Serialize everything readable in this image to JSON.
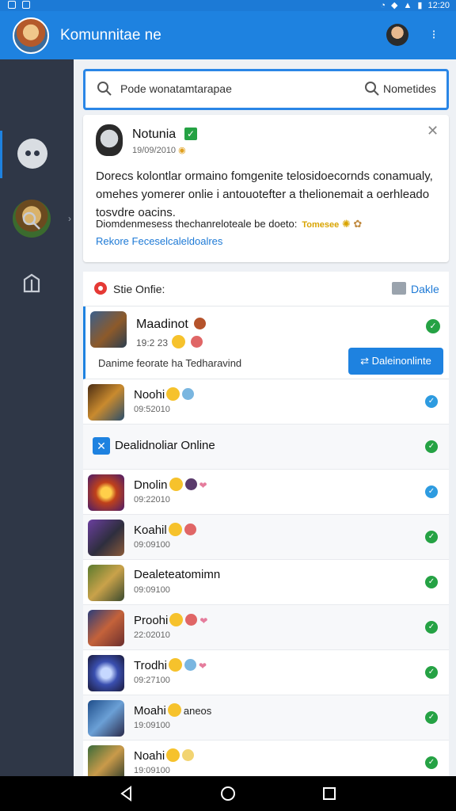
{
  "status_bar": {
    "time": "12:20"
  },
  "header": {
    "title": "Komunnitae ne"
  },
  "search": {
    "placeholder": "Pode wonatamtarapae",
    "right_label": "Nometides"
  },
  "notification": {
    "title": "Notunia",
    "subtitle": "19/09/2010",
    "body": "Dorecs kolontlar ormaino fomgenite telosidoecornds conamualy, omehes yomerer onlie i antouotefter a thelionemait a oerhleado tosvdre oacins.",
    "line4": "Diomdenmesess thechanreloteale be doeto:",
    "badge": "Tomesee",
    "link": "Rekore Feceselcaleldoalres"
  },
  "list": {
    "header_title": "Stie Onfie:",
    "header_link": "Dakle",
    "featured": {
      "name": "Maadinot",
      "sub": "19:2 23",
      "desc": "Danime feorate ha Tedharavind",
      "button": "Daleinonlinte"
    },
    "rows": [
      {
        "name": "Noohi",
        "sub": "09:52010",
        "check": "blue",
        "extra": ""
      },
      {
        "subheader": "Dealidnoliar Online"
      },
      {
        "name": "Dnolin",
        "sub": "09:22010",
        "check": "blue",
        "extra": ""
      },
      {
        "name": "Koahil",
        "sub": "09:09100",
        "check": "green",
        "extra": ""
      },
      {
        "name": "Dealeteatomimn",
        "sub": "09:09100",
        "check": "green",
        "extra": ""
      },
      {
        "name": "Proohi",
        "sub": "22:02010",
        "check": "green",
        "extra": ""
      },
      {
        "name": "Trodhi",
        "sub": "09:27100",
        "check": "green",
        "extra": ""
      },
      {
        "name": "Moahi",
        "sub": "19:09100",
        "check": "green",
        "extra": "aneos"
      },
      {
        "name": "Noahi",
        "sub": "19:09100",
        "check": "green",
        "extra": ""
      }
    ]
  },
  "colors": {
    "primary": "#1e82e0",
    "sidebar": "#2f3747",
    "success": "#25a244"
  }
}
